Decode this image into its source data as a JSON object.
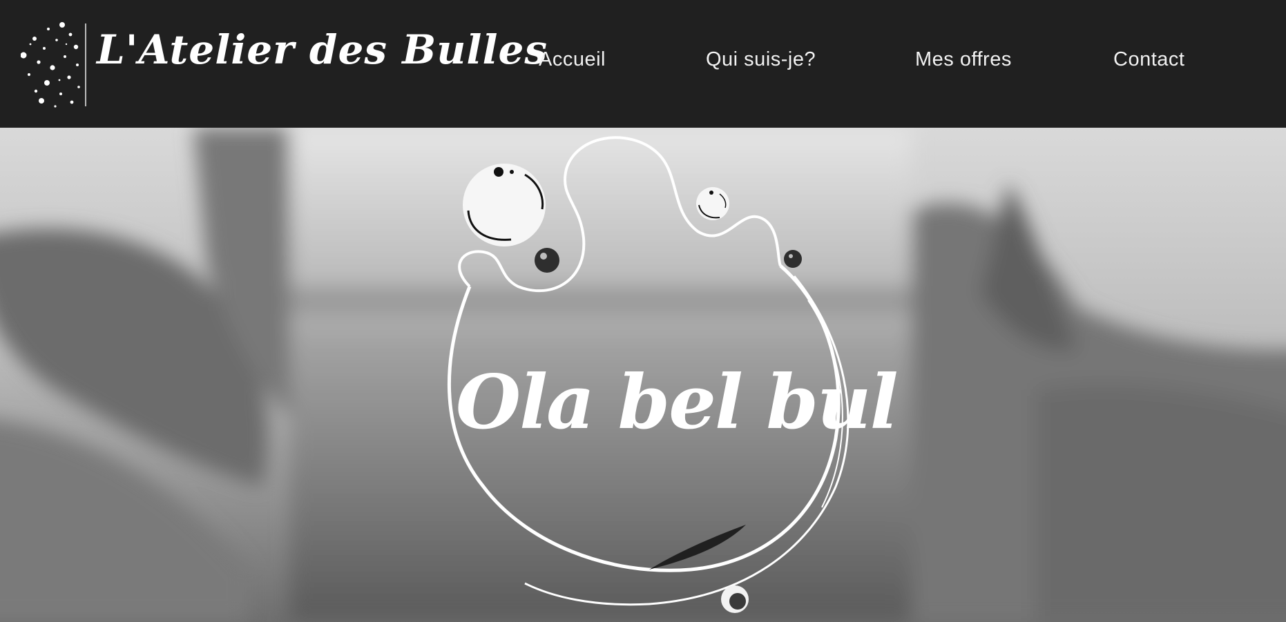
{
  "header": {
    "logo_text": "L'Atelier des Bulles",
    "background": "#202020"
  },
  "nav": {
    "items": [
      {
        "label": "Accueil"
      },
      {
        "label": "Qui suis-je?"
      },
      {
        "label": "Mes offres"
      },
      {
        "label": "Contact"
      }
    ]
  },
  "hero": {
    "emblem_title": "Ola bel bul"
  },
  "icons": {
    "logo_mark": "sparkles-icon",
    "emblem": "bubble-emblem"
  }
}
